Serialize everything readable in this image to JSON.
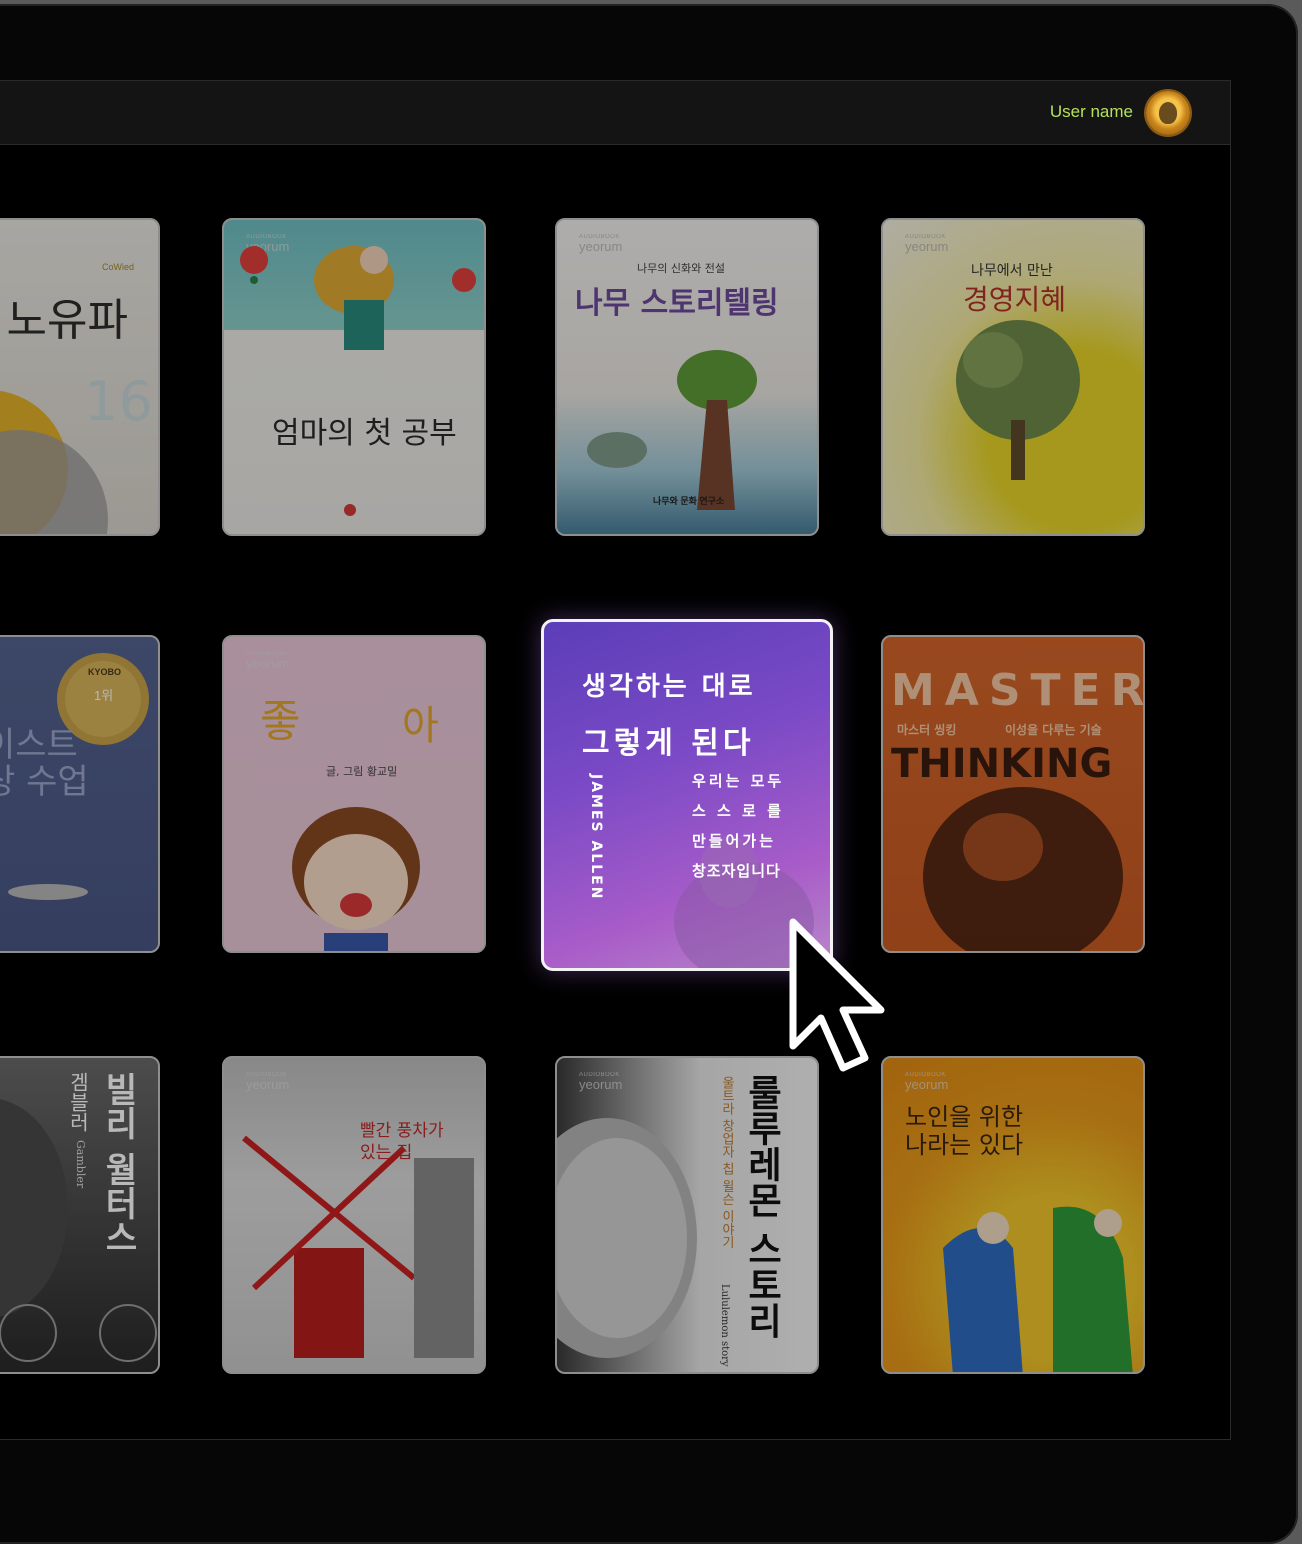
{
  "header": {
    "username": "User name"
  },
  "books": [
    {
      "id": "book-1",
      "publisher": "",
      "line1": "노유파",
      "line2": "CoWied"
    },
    {
      "id": "book-2",
      "publisher": "yeorum",
      "label": "AUDIOBOOK",
      "title": "엄마의 첫 공부"
    },
    {
      "id": "book-3",
      "publisher": "yeorum",
      "label": "AUDIOBOOK",
      "subtitle": "나무의 신화와 전설",
      "title": "나무 스토리텔링",
      "footer": "나무와 문화 연구소"
    },
    {
      "id": "book-4",
      "publisher": "yeorum",
      "label": "AUDIOBOOK",
      "subtitle": "나무에서 만난",
      "title": "경영지혜"
    },
    {
      "id": "book-5",
      "badge_top": "KYOBO",
      "badge_rank": "1위",
      "title": "이스트\n상 수업"
    },
    {
      "id": "book-6",
      "publisher": "yeorum",
      "label": "AUDIOBOOK",
      "title_left": "좋",
      "title_right": "아",
      "author": "글, 그림 황교밀"
    },
    {
      "id": "book-7",
      "title_l1": "생각하는 대로",
      "title_l2": "그렇게 된다",
      "author": "JAMES ALLEN",
      "sub1": "우리는 모두",
      "sub2": "스 스 로 를",
      "sub3": "만들어가는",
      "sub4": "창조자입니다"
    },
    {
      "id": "book-8",
      "title_top": "MASTER",
      "sub_left": "마스터 씽킹",
      "sub_right": "이성을 다루는 기술",
      "title_bottom": "THINKING"
    },
    {
      "id": "book-9",
      "title": "빌리 월터스",
      "sub": "겜블러",
      "sub_en": "Gambler"
    },
    {
      "id": "book-10",
      "publisher": "yeorum",
      "label": "AUDIOBOOK",
      "title": "빨간 풍차가\n있는 집"
    },
    {
      "id": "book-11",
      "publisher": "yeorum",
      "label": "AUDIOBOOK",
      "title": "룰루레몬 스토리",
      "sub": "울트라 창업자 칩 윌슨 이야기",
      "sub_en": "Lululemon story"
    },
    {
      "id": "book-12",
      "publisher": "yeorum",
      "label": "AUDIOBOOK",
      "title": "노인을 위한\n나라는 있다"
    }
  ]
}
